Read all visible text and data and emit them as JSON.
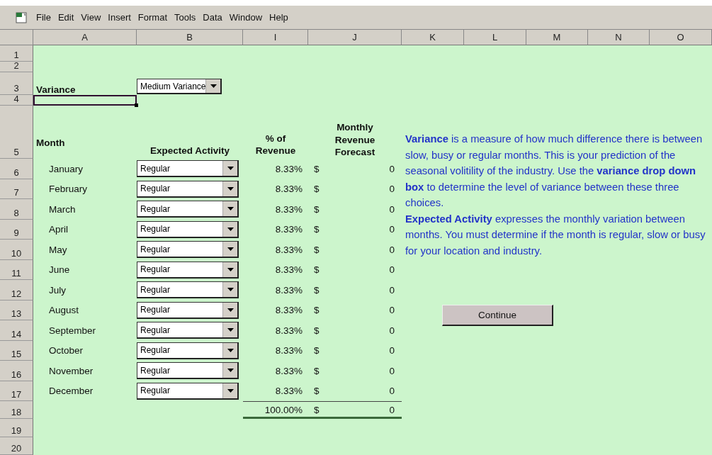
{
  "menu_bar": {
    "items": [
      "File",
      "Edit",
      "View",
      "Insert",
      "Format",
      "Tools",
      "Data",
      "Window",
      "Help"
    ]
  },
  "columns": [
    "A",
    "B",
    "I",
    "J",
    "K",
    "L",
    "M",
    "N",
    "O"
  ],
  "row_numbers": [
    "1",
    "2",
    "3",
    "4",
    "5",
    "6",
    "7",
    "8",
    "9",
    "10",
    "11",
    "12",
    "13",
    "14",
    "15",
    "16",
    "17",
    "18",
    "19",
    "20"
  ],
  "variance": {
    "label": "Variance",
    "value": "Medium Variance",
    "input_cell_selected": true
  },
  "headers": [
    "Month",
    "Expected Activity",
    "% of Revenue",
    "Monthly Revenue Forecast"
  ],
  "months": [
    {
      "month": "January",
      "activity": "Regular",
      "percent": "8.33%",
      "currency": "$",
      "forecast": "0"
    },
    {
      "month": "February",
      "activity": "Regular",
      "percent": "8.33%",
      "currency": "$",
      "forecast": "0"
    },
    {
      "month": "March",
      "activity": "Regular",
      "percent": "8.33%",
      "currency": "$",
      "forecast": "0"
    },
    {
      "month": "April",
      "activity": "Regular",
      "percent": "8.33%",
      "currency": "$",
      "forecast": "0"
    },
    {
      "month": "May",
      "activity": "Regular",
      "percent": "8.33%",
      "currency": "$",
      "forecast": "0"
    },
    {
      "month": "June",
      "activity": "Regular",
      "percent": "8.33%",
      "currency": "$",
      "forecast": "0"
    },
    {
      "month": "July",
      "activity": "Regular",
      "percent": "8.33%",
      "currency": "$",
      "forecast": "0"
    },
    {
      "month": "August",
      "activity": "Regular",
      "percent": "8.33%",
      "currency": "$",
      "forecast": "0"
    },
    {
      "month": "September",
      "activity": "Regular",
      "percent": "8.33%",
      "currency": "$",
      "forecast": "0"
    },
    {
      "month": "October",
      "activity": "Regular",
      "percent": "8.33%",
      "currency": "$",
      "forecast": "0"
    },
    {
      "month": "November",
      "activity": "Regular",
      "percent": "8.33%",
      "currency": "$",
      "forecast": "0"
    },
    {
      "month": "December",
      "activity": "Regular",
      "percent": "8.33%",
      "currency": "$",
      "forecast": "0"
    }
  ],
  "total": {
    "percent": "100.00%",
    "currency": "$",
    "forecast": "0"
  },
  "notes": [
    "**Variance** is a measure of how much difference there is between slow, busy or regular months.  This is your prediction of the seasonal volitility of the industry. Use the **variance drop down box**  to determine the level of variance between these three choices.",
    "**Expected Activity** expresses the monthly variation between months.  You must determine if the month is regular, slow or busy for your location and industry."
  ],
  "continue_button": "Continue"
}
